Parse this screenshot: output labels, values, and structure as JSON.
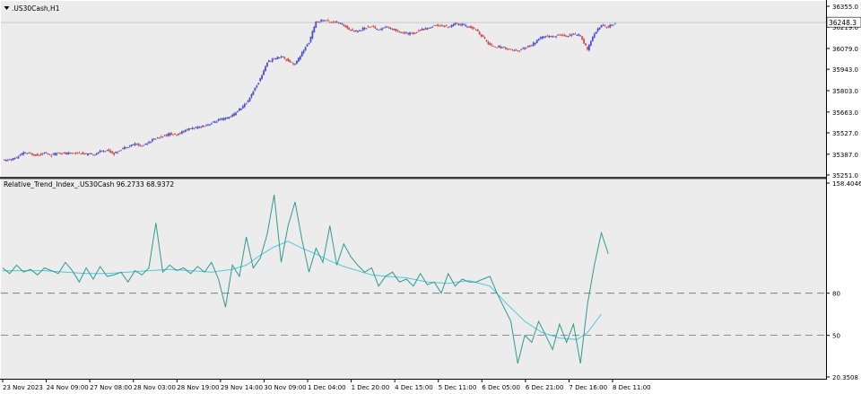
{
  "colors": {
    "background": "#ececec",
    "grid": "#c8c8c8",
    "candle_up": "#4b4bd6",
    "candle_down": "#c9504a",
    "rti_main": "#2e9b93",
    "rti_signal": "#54c6d9",
    "level_line": "#6e6e6e",
    "price_label_bg": "#ffffff"
  },
  "price_panel": {
    "title": ".US30Cash,H1",
    "title_icon": "triangle-down-icon",
    "current_price_label": "36248.3"
  },
  "indicator_panel": {
    "title": "Relative_Trend_Index_.US30Cash 96.2733 68.9372"
  },
  "chart_data": [
    {
      "type": "candlestick",
      "ylim": [
        35251.0,
        36355.0
      ],
      "y_ticks": [
        "36355.0",
        "36219.0",
        "36079.0",
        "35943.0",
        "35803.0",
        "35663.0",
        "35527.0",
        "35387.0",
        "35251.0"
      ],
      "current_price": 36248.3,
      "x_ticks": [
        "23 Nov 2023",
        "24 Nov 09:00",
        "27 Nov 08:00",
        "28 Nov 03:00",
        "28 Nov 19:00",
        "29 Nov 14:00",
        "30 Nov 09:00",
        "1 Dec 04:00",
        "1 Dec 20:00",
        "4 Dec 15:00",
        "5 Dec 11:00",
        "6 Dec 05:00",
        "6 Dec 21:00",
        "7 Dec 16:00",
        "8 Dec 11:00"
      ],
      "close_path": [
        [
          0,
          35345
        ],
        [
          4,
          35350
        ],
        [
          8,
          35365
        ],
        [
          12,
          35395
        ],
        [
          16,
          35390
        ],
        [
          20,
          35380
        ],
        [
          24,
          35395
        ],
        [
          28,
          35380
        ],
        [
          32,
          35400
        ],
        [
          36,
          35390
        ],
        [
          40,
          35395
        ],
        [
          44,
          35395
        ],
        [
          48,
          35385
        ],
        [
          52,
          35385
        ],
        [
          56,
          35405
        ],
        [
          60,
          35415
        ],
        [
          64,
          35390
        ],
        [
          68,
          35420
        ],
        [
          72,
          35440
        ],
        [
          76,
          35455
        ],
        [
          80,
          35440
        ],
        [
          84,
          35470
        ],
        [
          88,
          35490
        ],
        [
          92,
          35505
        ],
        [
          96,
          35520
        ],
        [
          100,
          35510
        ],
        [
          104,
          35540
        ],
        [
          108,
          35555
        ],
        [
          112,
          35560
        ],
        [
          116,
          35575
        ],
        [
          120,
          35590
        ],
        [
          124,
          35610
        ],
        [
          128,
          35620
        ],
        [
          132,
          35640
        ],
        [
          136,
          35680
        ],
        [
          140,
          35720
        ],
        [
          144,
          35800
        ],
        [
          148,
          35880
        ],
        [
          152,
          35990
        ],
        [
          156,
          36010
        ],
        [
          160,
          36030
        ],
        [
          164,
          36000
        ],
        [
          168,
          35975
        ],
        [
          172,
          36050
        ],
        [
          176,
          36120
        ],
        [
          180,
          36250
        ],
        [
          184,
          36265
        ],
        [
          188,
          36255
        ],
        [
          192,
          36250
        ],
        [
          196,
          36230
        ],
        [
          200,
          36200
        ],
        [
          204,
          36190
        ],
        [
          208,
          36215
        ],
        [
          212,
          36225
        ],
        [
          216,
          36200
        ],
        [
          220,
          36220
        ],
        [
          224,
          36205
        ],
        [
          228,
          36190
        ],
        [
          232,
          36175
        ],
        [
          236,
          36180
        ],
        [
          240,
          36200
        ],
        [
          244,
          36210
        ],
        [
          248,
          36230
        ],
        [
          252,
          36230
        ],
        [
          256,
          36220
        ],
        [
          260,
          36240
        ],
        [
          264,
          36235
        ],
        [
          268,
          36220
        ],
        [
          272,
          36200
        ],
        [
          276,
          36150
        ],
        [
          280,
          36100
        ],
        [
          284,
          36090
        ],
        [
          288,
          36085
        ],
        [
          292,
          36070
        ],
        [
          296,
          36060
        ],
        [
          300,
          36085
        ],
        [
          304,
          36100
        ],
        [
          308,
          36140
        ],
        [
          312,
          36160
        ],
        [
          316,
          36155
        ],
        [
          320,
          36170
        ],
        [
          324,
          36160
        ],
        [
          328,
          36170
        ],
        [
          332,
          36165
        ],
        [
          336,
          36070
        ],
        [
          340,
          36180
        ],
        [
          344,
          36230
        ],
        [
          348,
          36220
        ],
        [
          352,
          36245
        ]
      ]
    },
    {
      "type": "line",
      "ylim": [
        20.3508,
        158.4046
      ],
      "y_ticks": [
        "158.4046",
        "80",
        "50",
        "20.3508"
      ],
      "levels": [
        80,
        50
      ],
      "series": [
        {
          "values": [
            [
              0,
              98
            ],
            [
              4,
              94
            ],
            [
              8,
              100
            ],
            [
              12,
              95
            ],
            [
              16,
              97
            ],
            [
              20,
              93
            ],
            [
              24,
              98
            ],
            [
              28,
              96
            ],
            [
              32,
              94
            ],
            [
              36,
              102
            ],
            [
              40,
              96
            ],
            [
              44,
              88
            ],
            [
              48,
              98
            ],
            [
              52,
              90
            ],
            [
              56,
              99
            ],
            [
              60,
              92
            ],
            [
              64,
              93
            ],
            [
              68,
              95
            ],
            [
              72,
              88
            ],
            [
              76,
              96
            ],
            [
              80,
              93
            ],
            [
              84,
              98
            ],
            [
              88,
              130
            ],
            [
              92,
              95
            ],
            [
              96,
              100
            ],
            [
              100,
              96
            ],
            [
              104,
              98
            ],
            [
              108,
              94
            ],
            [
              112,
              99
            ],
            [
              116,
              95
            ],
            [
              120,
              102
            ],
            [
              124,
              90
            ],
            [
              128,
              70
            ],
            [
              132,
              100
            ],
            [
              136,
              92
            ],
            [
              140,
              120
            ],
            [
              144,
              98
            ],
            [
              148,
              105
            ],
            [
              152,
              122
            ],
            [
              156,
              150
            ],
            [
              160,
              102
            ],
            [
              164,
              128
            ],
            [
              168,
              145
            ],
            [
              172,
              118
            ],
            [
              176,
              95
            ],
            [
              180,
              112
            ],
            [
              184,
              102
            ],
            [
              188,
              128
            ],
            [
              192,
              100
            ],
            [
              196,
              115
            ],
            [
              200,
              106
            ],
            [
              204,
              100
            ],
            [
              208,
              95
            ],
            [
              212,
              98
            ],
            [
              216,
              85
            ],
            [
              220,
              92
            ],
            [
              224,
              95
            ],
            [
              228,
              88
            ],
            [
              232,
              90
            ],
            [
              236,
              85
            ],
            [
              240,
              94
            ],
            [
              244,
              86
            ],
            [
              248,
              88
            ],
            [
              252,
              80
            ],
            [
              256,
              94
            ],
            [
              260,
              85
            ],
            [
              264,
              90
            ],
            [
              268,
              88
            ],
            [
              272,
              88
            ],
            [
              276,
              90
            ],
            [
              280,
              92
            ],
            [
              284,
              80
            ],
            [
              288,
              70
            ],
            [
              292,
              60
            ],
            [
              296,
              30
            ],
            [
              300,
              50
            ],
            [
              304,
              45
            ],
            [
              308,
              60
            ],
            [
              312,
              50
            ],
            [
              316,
              40
            ],
            [
              320,
              58
            ],
            [
              324,
              45
            ],
            [
              328,
              58
            ],
            [
              332,
              30
            ],
            [
              336,
              72
            ],
            [
              340,
              100
            ],
            [
              344,
              123
            ],
            [
              348,
              108
            ]
          ]
        },
        {
          "values": [
            [
              0,
              96
            ],
            [
              12,
              96
            ],
            [
              24,
              96
            ],
            [
              36,
              95
            ],
            [
              48,
              94
            ],
            [
              60,
              94
            ],
            [
              72,
              95
            ],
            [
              84,
              96
            ],
            [
              96,
              97
            ],
            [
              108,
              96
            ],
            [
              120,
              95
            ],
            [
              132,
              97
            ],
            [
              140,
              100
            ],
            [
              148,
              107
            ],
            [
              156,
              113
            ],
            [
              164,
              117
            ],
            [
              172,
              112
            ],
            [
              180,
              108
            ],
            [
              188,
              103
            ],
            [
              196,
              99
            ],
            [
              204,
              96
            ],
            [
              212,
              93
            ],
            [
              220,
              92
            ],
            [
              232,
              91
            ],
            [
              244,
              88
            ],
            [
              256,
              87
            ],
            [
              268,
              89
            ],
            [
              280,
              85
            ],
            [
              290,
              72
            ],
            [
              300,
              60
            ],
            [
              310,
              52
            ],
            [
              320,
              48
            ],
            [
              330,
              47
            ],
            [
              336,
              52
            ],
            [
              344,
              65
            ]
          ]
        }
      ]
    }
  ]
}
